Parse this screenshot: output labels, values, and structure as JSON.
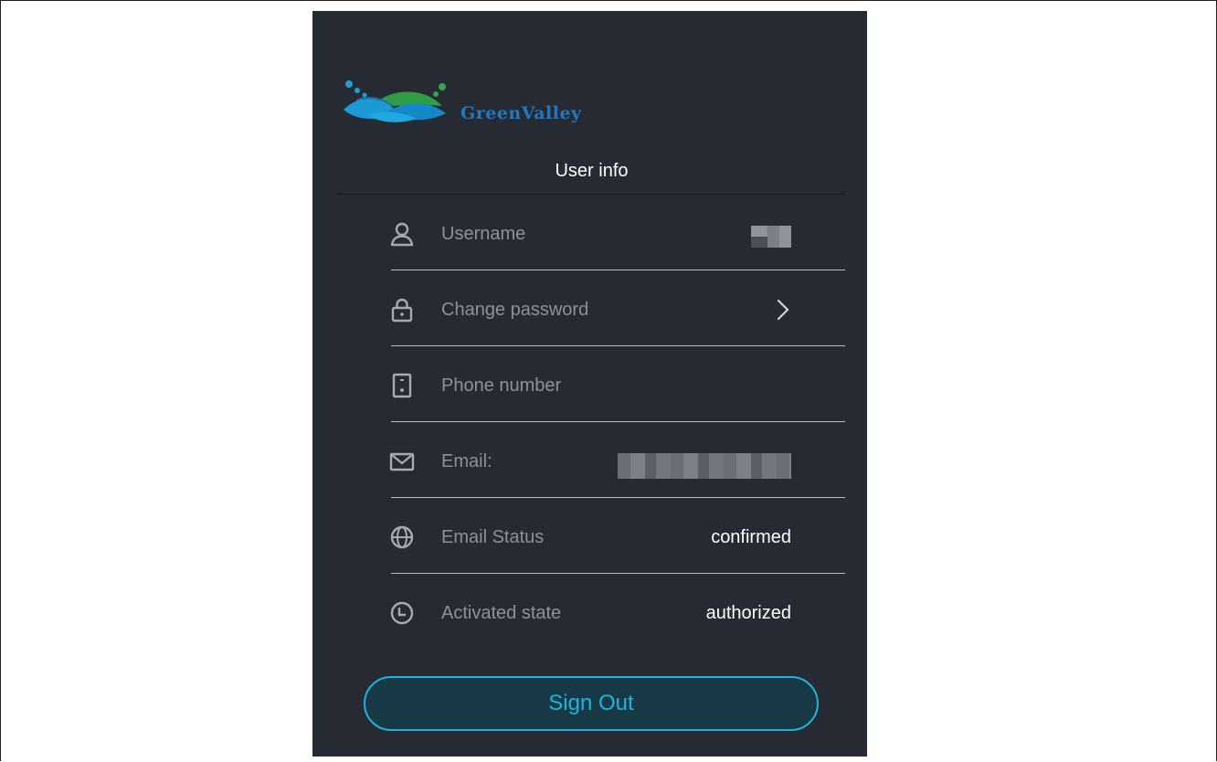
{
  "app": {
    "logo_text": "GreenValley",
    "title": "User info"
  },
  "rows": [
    {
      "key": "username",
      "label": "Username",
      "icon": "user-icon",
      "value": ""
    },
    {
      "key": "change_password",
      "label": "Change password",
      "icon": "lock-icon",
      "action": "chevron-right-icon"
    },
    {
      "key": "phone",
      "label": "Phone number",
      "icon": "phone-icon",
      "value": ""
    },
    {
      "key": "email",
      "label": "Email:",
      "icon": "mail-icon",
      "value": ""
    },
    {
      "key": "email_status",
      "label": "Email Status",
      "icon": "globe-icon",
      "value": "confirmed"
    },
    {
      "key": "activated_state",
      "label": "Activated state",
      "icon": "clock-icon",
      "value": "authorized"
    }
  ],
  "signout_label": "Sign Out",
  "colors": {
    "panel_bg": "#252a33",
    "accent": "#1fb3dd",
    "label": "#8d929a",
    "value": "#ffffff"
  }
}
